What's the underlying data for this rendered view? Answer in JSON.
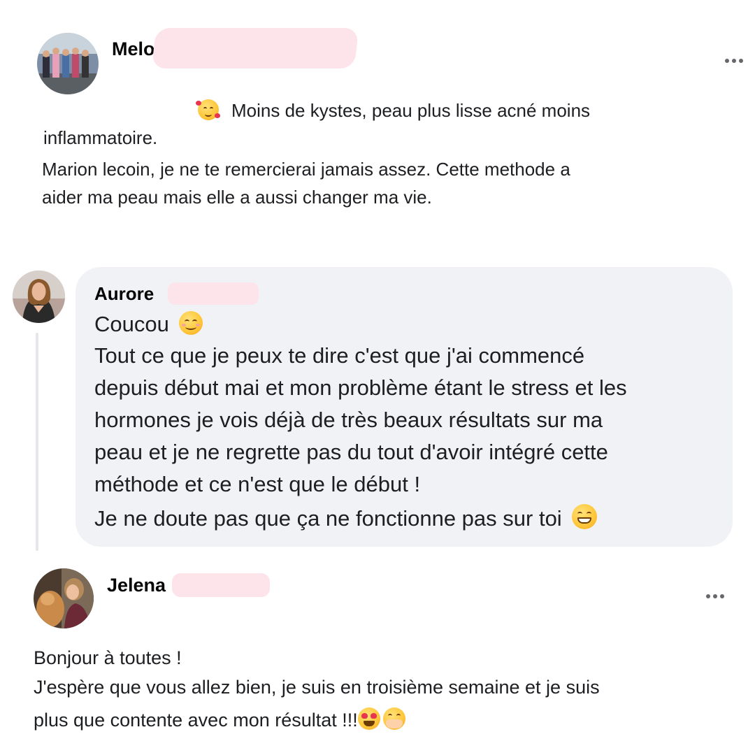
{
  "comments": [
    {
      "author": "Melo",
      "avatar_icon": "group-photo-avatar",
      "lines": [
        "Moins de kystes, peau plus lisse acné moins",
        "inflammatoire.",
        "Marion lecoin,  je ne te remercierai jamais assez. Cette methode a",
        "aider ma peau mais elle a aussi changer ma vie."
      ],
      "emojis": [
        "smiling-face-with-hearts"
      ]
    },
    {
      "author": "Aurore",
      "avatar_icon": "woman-portrait-avatar",
      "lines": [
        "Coucou",
        "Tout ce que je peux te dire c'est que j'ai commencé",
        "depuis début mai et mon problème étant le stress et les",
        "hormones je vois déjà de très beaux résultats sur ma",
        "peau et je ne regrette pas du tout d'avoir intégré cette",
        "méthode et ce n'est que le début !",
        "Je ne doute pas que ça ne fonctionne pas sur toi"
      ],
      "emojis": [
        "smiling-face-with-smiling-eyes",
        "beaming-face-with-smiling-eyes"
      ]
    },
    {
      "author": "Jelena",
      "avatar_icon": "woman-with-dog-avatar",
      "lines": [
        "Bonjour à toutes !",
        "J'espère que vous allez bien, je suis en troisième semaine et je suis",
        "plus que contente avec mon résultat !!!"
      ],
      "emojis": [
        "smiling-face-with-heart-eyes",
        "face-with-hand-over-mouth"
      ]
    }
  ],
  "menu_icon": "more-options-icon",
  "colors": {
    "bubble_bg": "#f0f2f5",
    "text": "#1c1e21",
    "redaction": "#fde4ea",
    "dots": "#65676b"
  }
}
